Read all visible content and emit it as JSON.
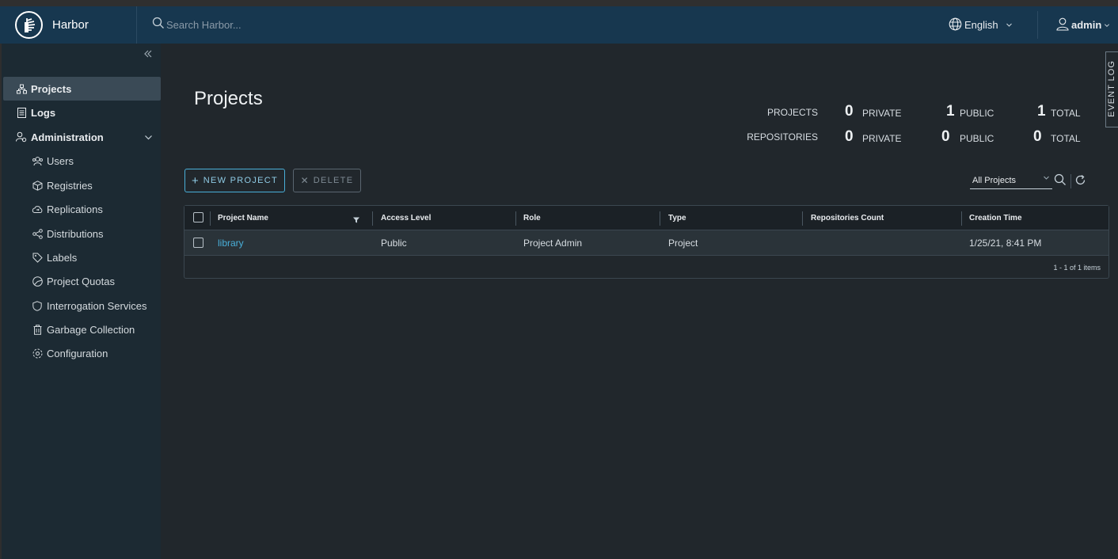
{
  "header": {
    "brand_name": "Harbor",
    "search_placeholder": "Search Harbor...",
    "language": "English",
    "user": "admin"
  },
  "sidebar": {
    "items": [
      {
        "label": "Projects",
        "icon": "projects-icon",
        "active": true
      },
      {
        "label": "Logs",
        "icon": "logs-icon"
      },
      {
        "label": "Administration",
        "icon": "administration-icon",
        "expanded": true
      },
      {
        "label": "Users",
        "icon": "users-icon"
      },
      {
        "label": "Registries",
        "icon": "registries-icon"
      },
      {
        "label": "Replications",
        "icon": "replications-icon"
      },
      {
        "label": "Distributions",
        "icon": "distributions-icon"
      },
      {
        "label": "Labels",
        "icon": "labels-icon"
      },
      {
        "label": "Project Quotas",
        "icon": "project-quotas-icon"
      },
      {
        "label": "Interrogation Services",
        "icon": "interrogation-services-icon"
      },
      {
        "label": "Garbage Collection",
        "icon": "garbage-collection-icon"
      },
      {
        "label": "Configuration",
        "icon": "configuration-icon"
      }
    ]
  },
  "main": {
    "title": "Projects",
    "event_log": "EVENT LOG",
    "stats": {
      "projects_label": "PROJECTS",
      "repositories_label": "REPOSITORIES",
      "private_word": "PRIVATE",
      "public_word": "PUBLIC",
      "total_word": "TOTAL",
      "projects_private": "0",
      "projects_public": "1",
      "projects_total": "1",
      "repos_private": "0",
      "repos_public": "0",
      "repos_total": "0"
    },
    "toolbar": {
      "new_project": "NEW PROJECT",
      "delete": "DELETE",
      "filter_value": "All Projects"
    },
    "table": {
      "columns": [
        "Project Name",
        "Access Level",
        "Role",
        "Type",
        "Repositories Count",
        "Creation Time"
      ],
      "rows": [
        {
          "name": "library",
          "access": "Public",
          "role": "Project Admin",
          "type": "Project",
          "repo_count": "",
          "created": "1/25/21, 8:41 PM"
        }
      ],
      "footer": "1 - 1 of 1 items"
    }
  },
  "colors": {
    "header_bg": "#17374f",
    "sidebar_bg": "#1c2a33",
    "main_bg": "#21272c",
    "accent": "#49afd9"
  }
}
